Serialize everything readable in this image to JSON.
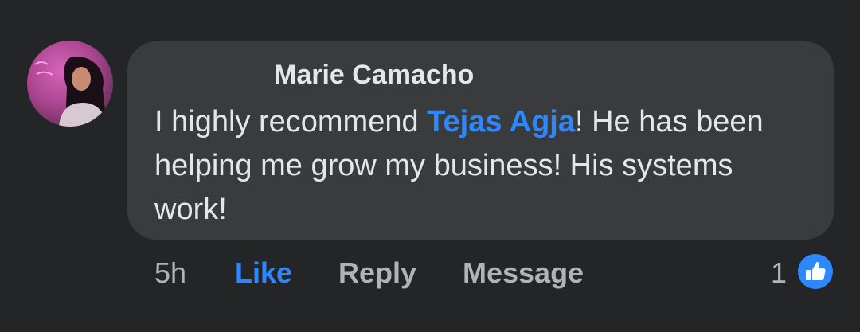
{
  "comment": {
    "author": "Marie Camacho",
    "text_before": "I highly recommend ",
    "mention": "Tejas Agja",
    "text_after": "! He has been helping me grow my business! His systems work!"
  },
  "actions": {
    "time": "5h",
    "like": "Like",
    "reply": "Reply",
    "message": "Message"
  },
  "reactions": {
    "count": "1",
    "icon": "thumbs-up-icon"
  },
  "colors": {
    "background": "#242526",
    "bubble": "#3a3b3c",
    "text": "#e4e6eb",
    "muted": "#b0b3b8",
    "accent": "#2d88ff"
  }
}
